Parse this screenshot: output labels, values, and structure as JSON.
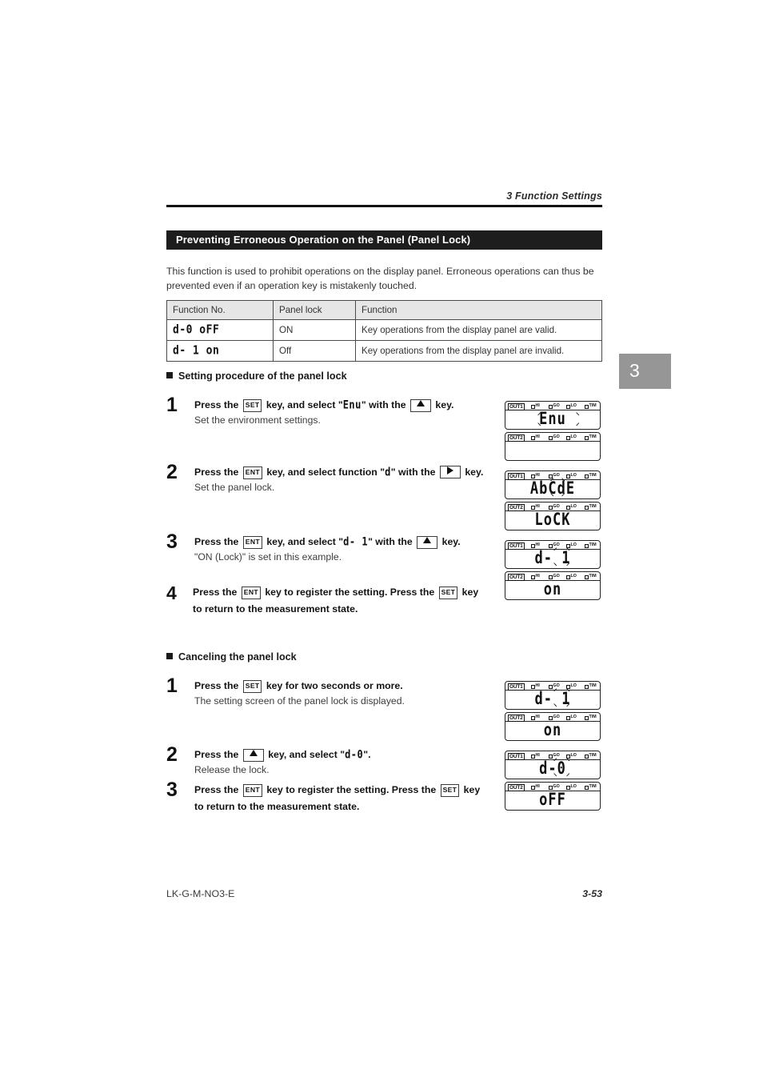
{
  "header": {
    "chapter_label": "3  Function Settings"
  },
  "section": {
    "title": "Preventing Erroneous Operation on the Panel (Panel Lock)"
  },
  "intro": "This function is used to prohibit operations on the display panel.  Erroneous operations can thus be prevented even if an operation key is mistakenly touched.",
  "table": {
    "headers": [
      "Function No.",
      "Panel lock",
      "Function"
    ],
    "rows": [
      {
        "function_no": "d-0 oFF",
        "panel_lock": "ON",
        "function": "Key operations from the display panel are valid."
      },
      {
        "function_no": "d- 1 on",
        "panel_lock": "Off",
        "function": "Key operations from the display panel are invalid."
      }
    ]
  },
  "procedure": {
    "heading": "Setting procedure of the panel lock",
    "steps": [
      {
        "num": "1",
        "t1": "Press the",
        "key1": "SET",
        "t2": "key, and select \"",
        "seg": "Enu",
        "t3": "\" with the",
        "key2": "up-arrow",
        "t4": "key.",
        "sub": "Set the environment settings."
      },
      {
        "num": "2",
        "t1": "Press the",
        "key1": "ENT",
        "t2": "key, and select function \"",
        "seg": "d",
        "t3": "\" with the",
        "key2": "right-arrow",
        "t4": "key.",
        "sub": "Set the panel lock."
      },
      {
        "num": "3",
        "t1": "Press the",
        "key1": "ENT",
        "t2": "key, and select \"",
        "seg": "d- 1",
        "t3": "\" with the",
        "key2": "up-arrow",
        "t4": "key.",
        "sub": "\"ON (Lock)\" is set in this example."
      },
      {
        "num": "4",
        "t1": "Press the",
        "key1": "ENT",
        "t2": "key to register the setting. Press the",
        "key2": "SET",
        "t4": "key to return to the measurement state.",
        "sub": ""
      }
    ]
  },
  "cancel": {
    "heading": "Canceling the panel lock",
    "steps": [
      {
        "num": "1",
        "t1": "Press the",
        "key1": "SET",
        "t2": "key for two seconds or more.",
        "sub": "The setting screen of the panel lock is displayed."
      },
      {
        "num": "2",
        "t1": "Press the",
        "key1": "up-arrow",
        "t2": "key, and select \"",
        "seg": "d-0",
        "t3": "\".",
        "sub": "Release the lock."
      },
      {
        "num": "3",
        "t1": "Press the",
        "key1": "ENT",
        "t2": "key to register the setting. Press the",
        "key2": "SET",
        "t4": "key to return to the measurement state.",
        "sub": ""
      }
    ]
  },
  "lcd": {
    "indicators": [
      "HI",
      "GO",
      "LO",
      "TIM"
    ],
    "out1_label": "OUT1",
    "out2_label": "OUT2",
    "groups": [
      {
        "out1": "Enu",
        "out2": "",
        "blink_out1": true,
        "blink_out2": false
      },
      {
        "out1": "AbCdE",
        "out2": "LoCK",
        "blink_out1": true,
        "blink_out2": false
      },
      {
        "out1": "d- 1",
        "out2": "on",
        "blink_out1": true,
        "blink_out2": false
      },
      {
        "out1": "d- 1",
        "out2": "on",
        "blink_out1": true,
        "blink_out2": false
      },
      {
        "out1": "d-0",
        "out2": "oFF",
        "blink_out1": true,
        "blink_out2": false
      }
    ]
  },
  "chapter_tab": {
    "number": "3"
  },
  "footer": {
    "doc_code": "LK-G-M-NO3-E",
    "page": "3-53"
  },
  "colors": {
    "banner_bg": "#1d1d1d",
    "tab_gray": "#969696",
    "rule": "#111111"
  }
}
